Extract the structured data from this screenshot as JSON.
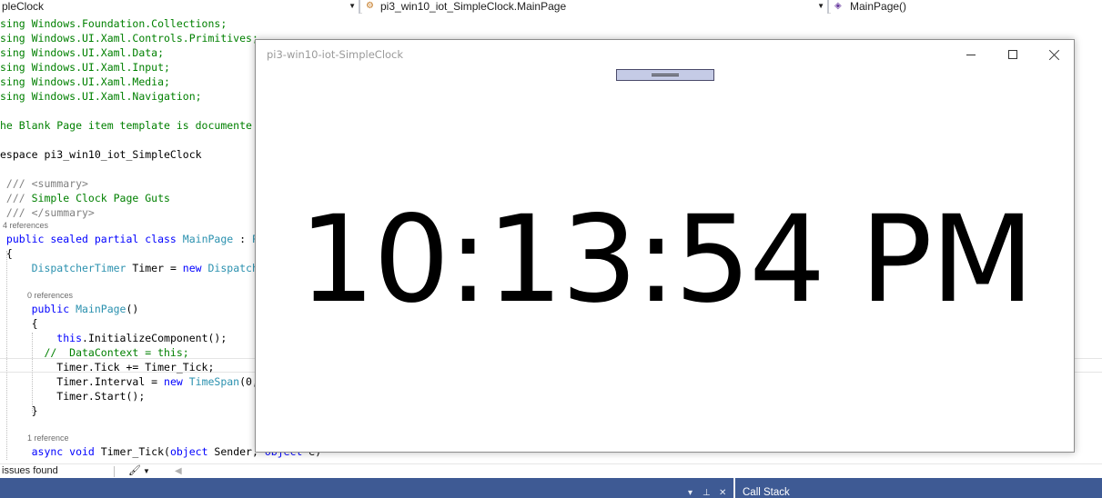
{
  "nav": {
    "project_combo": "pleClock",
    "class_combo": "pi3_win10_iot_SimpleClock.MainPage",
    "member_combo": "MainPage()"
  },
  "code": {
    "lines": [
      {
        "parts": [
          {
            "t": "sing Windows.Foundation.Collections;",
            "c": "green"
          }
        ]
      },
      {
        "parts": [
          {
            "t": "sing Windows.UI.Xaml.Controls.Primitives;",
            "c": "green"
          }
        ]
      },
      {
        "parts": [
          {
            "t": "sing Windows.UI.Xaml.Data;",
            "c": "green"
          }
        ]
      },
      {
        "parts": [
          {
            "t": "sing Windows.UI.Xaml.Input;",
            "c": "green"
          }
        ]
      },
      {
        "parts": [
          {
            "t": "sing Windows.UI.Xaml.Media;",
            "c": "green"
          }
        ]
      },
      {
        "parts": [
          {
            "t": "sing Windows.UI.Xaml.Navigation;",
            "c": "green"
          }
        ]
      },
      {
        "parts": [
          {
            "t": "he Blank Page item template is documente",
            "c": "green"
          }
        ]
      },
      {
        "parts": [
          {
            "t": "espace pi3_win10_iot_SimpleClock",
            "c": "black"
          }
        ]
      },
      {
        "parts": [
          {
            "t": " /// ",
            "c": "gray"
          },
          {
            "t": "<summary>",
            "c": "gray"
          }
        ]
      },
      {
        "parts": [
          {
            "t": " /// ",
            "c": "gray"
          },
          {
            "t": "Simple Clock Page Guts",
            "c": "green"
          }
        ]
      },
      {
        "parts": [
          {
            "t": " /// ",
            "c": "gray"
          },
          {
            "t": "</summary>",
            "c": "gray"
          }
        ]
      },
      {
        "parts": [
          {
            "t": " public sealed partial class ",
            "c": "blue"
          },
          {
            "t": "MainPage",
            "c": "teal"
          },
          {
            "t": " : ",
            "c": "black"
          },
          {
            "t": "P",
            "c": "teal"
          }
        ]
      },
      {
        "parts": [
          {
            "t": " {",
            "c": "black"
          }
        ]
      },
      {
        "parts": [
          {
            "t": "     DispatcherTimer",
            "c": "teal"
          },
          {
            "t": " Timer = ",
            "c": "black"
          },
          {
            "t": "new ",
            "c": "blue"
          },
          {
            "t": "Dispatch",
            "c": "teal"
          }
        ]
      },
      {
        "parts": [
          {
            "t": "     public ",
            "c": "blue"
          },
          {
            "t": "MainPage",
            "c": "teal"
          },
          {
            "t": "()",
            "c": "black"
          }
        ]
      },
      {
        "parts": [
          {
            "t": "     {",
            "c": "black"
          }
        ]
      },
      {
        "parts": [
          {
            "t": "         this",
            "c": "blue"
          },
          {
            "t": ".InitializeComponent();",
            "c": "black"
          }
        ]
      },
      {
        "parts": [
          {
            "t": "       //  DataContext = this;",
            "c": "green"
          }
        ]
      },
      {
        "parts": [
          {
            "t": "         Timer.Tick += ",
            "c": "black"
          },
          {
            "t": "Timer_Tick",
            "c": "black"
          },
          {
            "t": ";",
            "c": "black"
          }
        ]
      },
      {
        "parts": [
          {
            "t": "         Timer.Interval = ",
            "c": "black"
          },
          {
            "t": "new ",
            "c": "blue"
          },
          {
            "t": "TimeSpan",
            "c": "teal"
          },
          {
            "t": "(0,",
            "c": "black"
          }
        ]
      },
      {
        "parts": [
          {
            "t": "         Timer.Start();",
            "c": "black"
          }
        ]
      },
      {
        "parts": [
          {
            "t": "     }",
            "c": "black"
          }
        ]
      },
      {
        "parts": [
          {
            "t": "     async void ",
            "c": "blue"
          },
          {
            "t": "Timer_Tick(",
            "c": "black"
          },
          {
            "t": "object ",
            "c": "blue"
          },
          {
            "t": "Sender, ",
            "c": "black"
          },
          {
            "t": "object ",
            "c": "blue"
          },
          {
            "t": "e)",
            "c": "black"
          }
        ]
      }
    ],
    "lens": [
      "4 references",
      "0 references",
      "1 reference"
    ]
  },
  "status": {
    "issues": "issues found"
  },
  "bottom": {
    "call_stack": "Call Stack"
  },
  "app": {
    "title": "pi3-win10-iot-SimpleClock",
    "time": "10:13:54 PM"
  }
}
